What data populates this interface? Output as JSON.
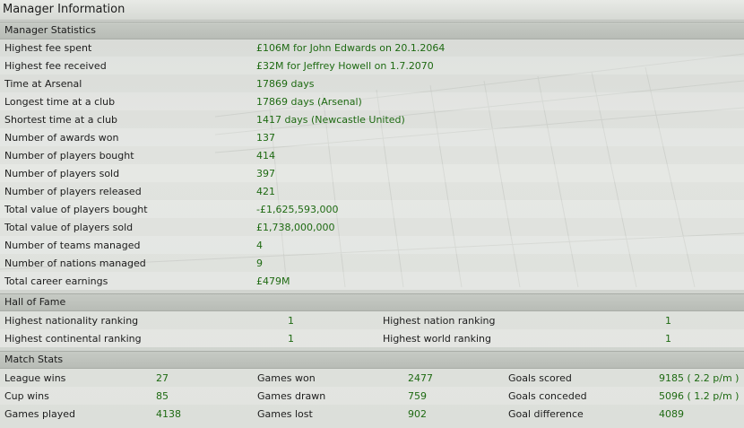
{
  "title": "Manager Information",
  "colors": {
    "value_green": "#1e6a12",
    "header_bg": "#bcc0ba"
  },
  "manager_statistics": {
    "heading": "Manager Statistics",
    "rows": [
      {
        "label": "Highest fee spent",
        "value": "£106M for John Edwards on 20.1.2064"
      },
      {
        "label": "Highest fee received",
        "value": "£32M for Jeffrey Howell on 1.7.2070"
      },
      {
        "label": "Time at Arsenal",
        "value": "17869 days"
      },
      {
        "label": "Longest time at a club",
        "value": "17869 days (Arsenal)"
      },
      {
        "label": "Shortest time at a club",
        "value": "1417 days (Newcastle United)"
      },
      {
        "label": "Number of awards won",
        "value": "137"
      },
      {
        "label": "Number of players bought",
        "value": "414"
      },
      {
        "label": "Number of players sold",
        "value": "397"
      },
      {
        "label": "Number of players released",
        "value": "421"
      },
      {
        "label": "Total value of players bought",
        "value": "-£1,625,593,000"
      },
      {
        "label": "Total value of players sold",
        "value": "£1,738,000,000"
      },
      {
        "label": "Number of teams managed",
        "value": "4"
      },
      {
        "label": "Number of nations managed",
        "value": "9"
      },
      {
        "label": "Total career earnings",
        "value": "£479M"
      }
    ]
  },
  "hall_of_fame": {
    "heading": "Hall of Fame",
    "rows": [
      {
        "left_label": "Highest nationality ranking",
        "left_value": "1",
        "right_label": "Highest nation ranking",
        "right_value": "1"
      },
      {
        "left_label": "Highest continental ranking",
        "left_value": "1",
        "right_label": "Highest world ranking",
        "right_value": "1"
      }
    ]
  },
  "match_stats": {
    "heading": "Match Stats",
    "rows": [
      {
        "c1_label": "League wins",
        "c1_value": "27",
        "c2_label": "Games won",
        "c2_value": "2477",
        "c3_label": "Goals scored",
        "c3_value": "9185 ( 2.2 p/m )"
      },
      {
        "c1_label": "Cup wins",
        "c1_value": "85",
        "c2_label": "Games drawn",
        "c2_value": "759",
        "c3_label": "Goals conceded",
        "c3_value": "5096 ( 1.2 p/m )"
      },
      {
        "c1_label": "Games played",
        "c1_value": "4138",
        "c2_label": "Games lost",
        "c2_value": "902",
        "c3_label": "Goal difference",
        "c3_value": "4089"
      }
    ]
  }
}
